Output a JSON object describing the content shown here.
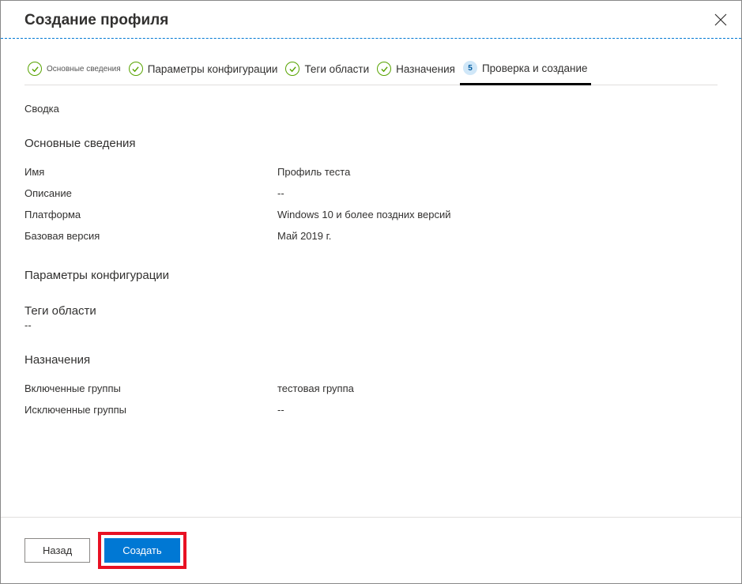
{
  "header": {
    "title": "Создание профиля"
  },
  "steps": [
    {
      "label": "Основные сведения",
      "state": "completed"
    },
    {
      "label": "Параметры конфигурации",
      "state": "completed"
    },
    {
      "label": "Теги области",
      "state": "completed"
    },
    {
      "label": "Назначения",
      "state": "completed"
    },
    {
      "number": "5",
      "label": "Проверка и создание",
      "state": "current"
    }
  ],
  "summary_label": "Сводка",
  "sections": {
    "basics": {
      "title": "Основные сведения",
      "rows": [
        {
          "key": "Имя",
          "val": "Профиль теста"
        },
        {
          "key": "Описание",
          "val": "--"
        },
        {
          "key": "Платформа",
          "val": "Windows 10 и более поздних версий"
        },
        {
          "key": "Базовая версия",
          "val": "Май 2019 г."
        }
      ]
    },
    "config": {
      "title": "Параметры конфигурации"
    },
    "scope": {
      "title": "Теги области",
      "value": "--"
    },
    "assignments": {
      "title": "Назначения",
      "rows": [
        {
          "key": "Включенные группы",
          "val": "тестовая группа"
        },
        {
          "key": "Исключенные группы",
          "val": "--"
        }
      ]
    }
  },
  "footer": {
    "back": "Назад",
    "create": "Создать"
  }
}
